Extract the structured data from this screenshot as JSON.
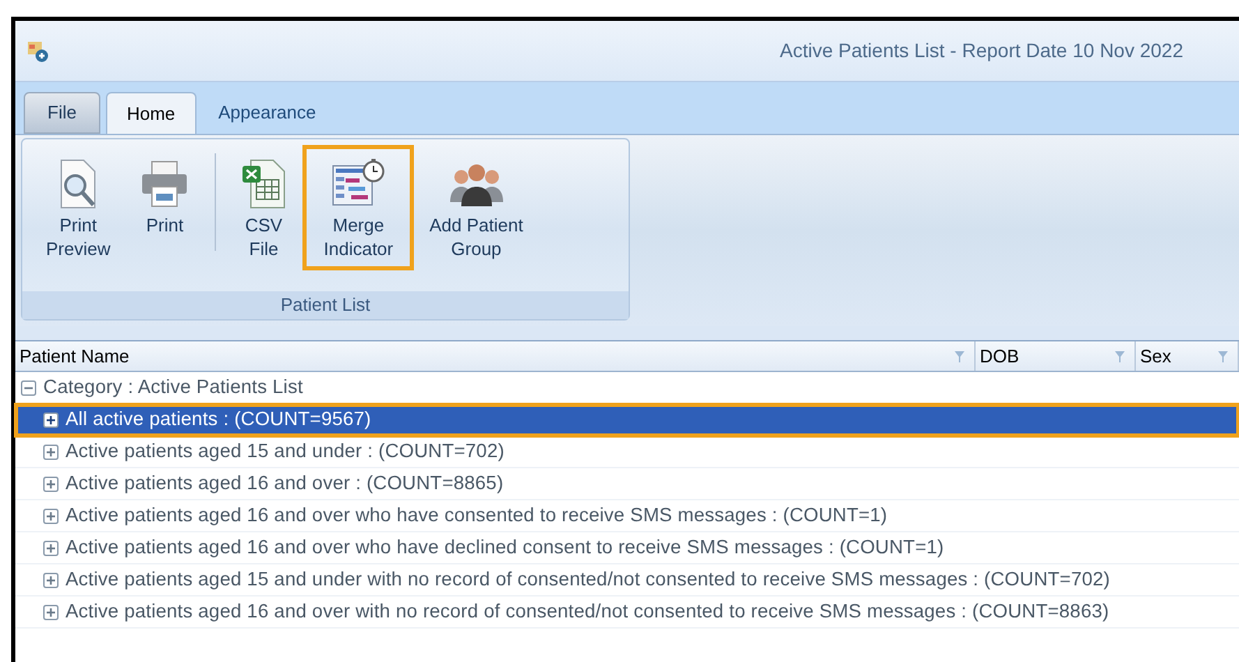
{
  "window": {
    "title": "Active Patients List - Report Date 10 Nov 2022"
  },
  "tabs": [
    {
      "label": "File",
      "kind": "file",
      "selected": false
    },
    {
      "label": "Home",
      "kind": "tab",
      "selected": true
    },
    {
      "label": "Appearance",
      "kind": "tab",
      "selected": false
    }
  ],
  "ribbon": {
    "groups": [
      {
        "label": "Patient List",
        "buttons": [
          {
            "label": "Print Preview",
            "kind": "preview",
            "highlighted": false
          },
          {
            "label": "Print",
            "kind": "print",
            "highlighted": false
          },
          {
            "label": "CSV File",
            "kind": "csv",
            "highlighted": false
          },
          {
            "label": "Merge Indicator",
            "kind": "merge",
            "highlighted": true
          },
          {
            "label": "Add Patient Group",
            "kind": "group",
            "highlighted": false
          }
        ]
      }
    ]
  },
  "table": {
    "columns": [
      {
        "label": "Patient Name"
      },
      {
        "label": "DOB"
      },
      {
        "label": "Sex"
      }
    ],
    "rows": [
      {
        "text": "Category : Active Patients List",
        "expanded": true,
        "selected": false,
        "highlighted": false,
        "children": [
          {
            "text": "All active patients : (COUNT=9567)",
            "expanded": false,
            "selected": true,
            "highlighted": true
          },
          {
            "text": "Active patients aged 15 and under : (COUNT=702)",
            "expanded": false,
            "selected": false,
            "highlighted": false
          },
          {
            "text": "Active patients aged 16 and over : (COUNT=8865)",
            "expanded": false,
            "selected": false,
            "highlighted": false
          },
          {
            "text": "Active patients aged 16 and over who have consented to receive SMS messages : (COUNT=1)",
            "expanded": false,
            "selected": false,
            "highlighted": false
          },
          {
            "text": "Active patients aged 16 and over who have declined consent to receive SMS messages : (COUNT=1)",
            "expanded": false,
            "selected": false,
            "highlighted": false
          },
          {
            "text": "Active patients aged 15 and under with no record of consented/not consented to receive SMS messages : (COUNT=702)",
            "expanded": false,
            "selected": false,
            "highlighted": false
          },
          {
            "text": "Active patients aged 16 and over with no record of consented/not consented to receive SMS messages : (COUNT=8863)",
            "expanded": false,
            "selected": false,
            "highlighted": false
          }
        ]
      }
    ]
  }
}
